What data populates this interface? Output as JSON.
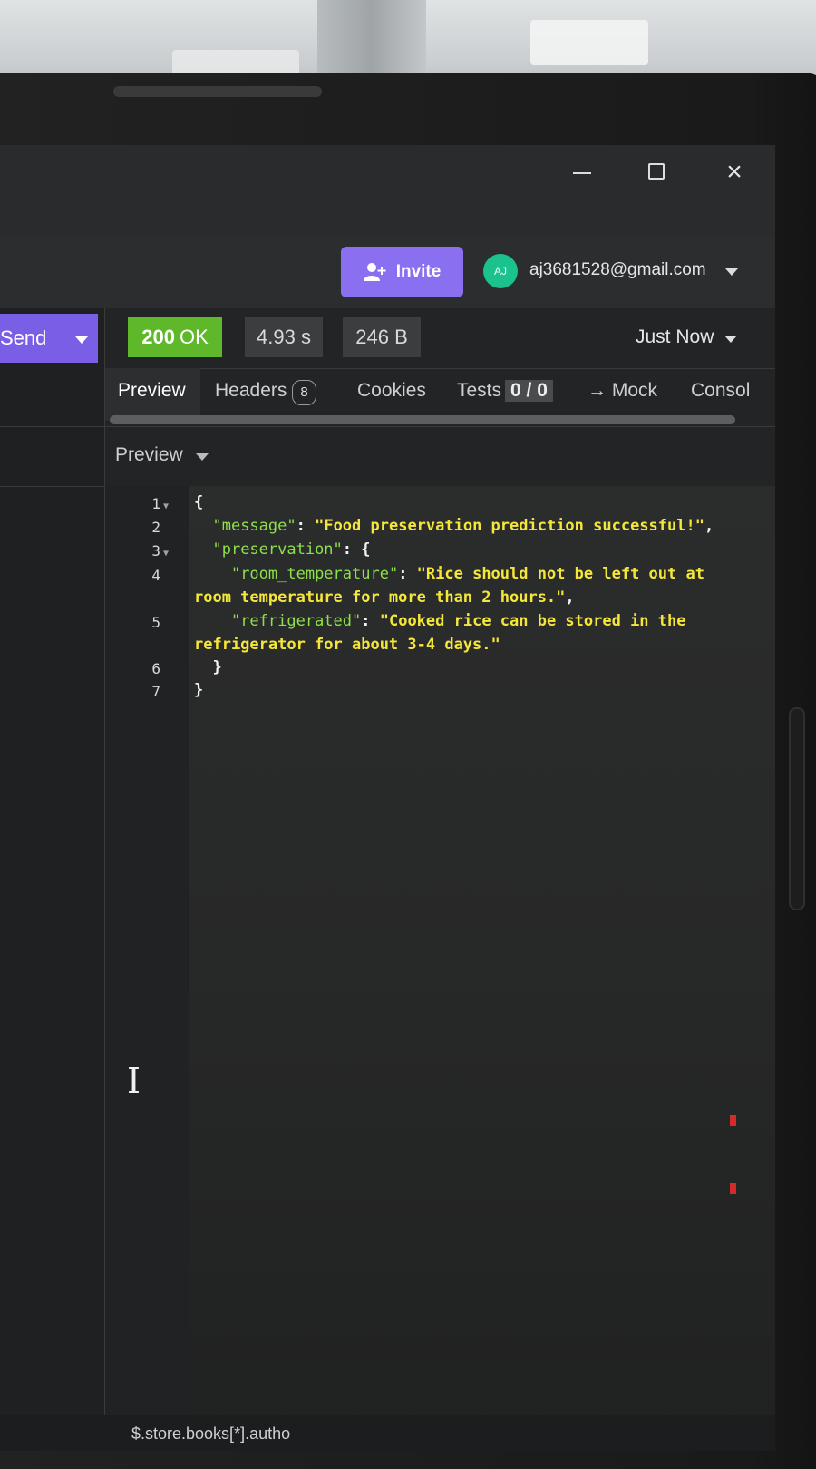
{
  "window": {
    "controls": {
      "minimize": "minimize-icon",
      "maximize": "maximize-icon",
      "close": "×"
    }
  },
  "header": {
    "invite_label": "Invite",
    "avatar_initials": "AJ",
    "user_email": "aj3681528@gmail.com"
  },
  "request": {
    "send_label": "Send"
  },
  "response": {
    "status_code": "200",
    "status_text": "OK",
    "time": "4.93 s",
    "size": "246 B",
    "history_label": "Just Now",
    "colors": {
      "status_ok": "#5fb82a",
      "invite": "#8a6ff0",
      "json_key": "#8ee04a",
      "json_string": "#f5e73a"
    }
  },
  "tabs": {
    "preview": "Preview",
    "headers": "Headers",
    "headers_count": "8",
    "cookies": "Cookies",
    "tests": "Tests",
    "tests_count": "0 / 0",
    "mock": "→ Mock",
    "console": "Consol"
  },
  "preview_mode": "Preview",
  "code": {
    "line_numbers": [
      "1",
      "2",
      "3",
      "4",
      "5",
      "6",
      "7"
    ],
    "lines": {
      "l1": "{",
      "l2_key": "\"message\"",
      "l2_val": "\"Food preservation prediction successful!\"",
      "l3_key": "\"preservation\"",
      "l4_key": "\"room_temperature\"",
      "l4_val_a": "\"Rice should not be left out at",
      "l4_val_b": "room temperature for more than 2 hours.\"",
      "l5_key": "\"refrigerated\"",
      "l5_val_a": "\"Cooked rice can be stored in the",
      "l5_val_b": "refrigerator for about 3-4 days.\"",
      "l6": "}",
      "l7": "}"
    }
  },
  "footer": {
    "filter_text": "$.store.books[*].autho"
  }
}
